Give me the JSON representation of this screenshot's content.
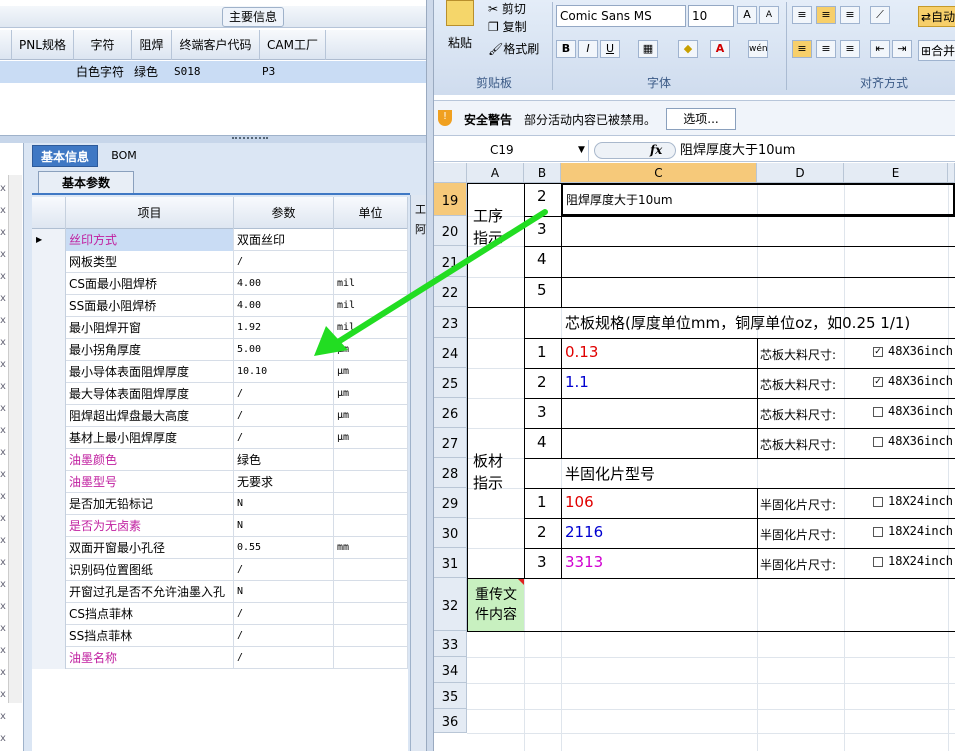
{
  "top_grid": {
    "group_title": "主要信息",
    "columns": [
      "PNL规格",
      "字符",
      "阻焊",
      "终端客户代码",
      "CAM工厂"
    ],
    "row": {
      "char": "白色字符",
      "solder": "绿色",
      "code": "S018",
      "factory": "P3"
    }
  },
  "param_panel": {
    "tabs": [
      "基本信息",
      "BOM"
    ],
    "subtab": "基本参数",
    "headers": [
      "项目",
      "参数",
      "单位"
    ],
    "right_tab_label": "工",
    "right_tab_label2": "阿",
    "rows": [
      {
        "item": "丝印方式",
        "value": "双面丝印",
        "unit": "",
        "highlight": true
      },
      {
        "item": "网板类型",
        "value": "/",
        "unit": ""
      },
      {
        "item": "CS面最小阻焊桥",
        "value": "4.00",
        "unit": "mil"
      },
      {
        "item": "SS面最小阻焊桥",
        "value": "4.00",
        "unit": "mil"
      },
      {
        "item": "最小阻焊开窗",
        "value": "1.92",
        "unit": "mil"
      },
      {
        "item": "最小拐角厚度",
        "value": "5.00",
        "unit": "μm"
      },
      {
        "item": "最小导体表面阻焊厚度",
        "value": "10.10",
        "unit": "μm"
      },
      {
        "item": "最大导体表面阻焊厚度",
        "value": "/",
        "unit": "μm"
      },
      {
        "item": "阻焊超出焊盘最大高度",
        "value": "/",
        "unit": "μm"
      },
      {
        "item": "基材上最小阻焊厚度",
        "value": "/",
        "unit": "μm"
      },
      {
        "item": "油墨颜色",
        "value": "绿色",
        "unit": "",
        "highlight": true
      },
      {
        "item": "油墨型号",
        "value": "无要求",
        "unit": "",
        "highlight": true
      },
      {
        "item": "是否加无铅标记",
        "value": "N",
        "unit": ""
      },
      {
        "item": "是否为无卤素",
        "value": "N",
        "unit": "",
        "highlight": true
      },
      {
        "item": "双面开窗最小孔径",
        "value": "0.55",
        "unit": "mm"
      },
      {
        "item": "识别码位置图纸",
        "value": "/",
        "unit": ""
      },
      {
        "item": "开窗过孔是否不允许油墨入孔",
        "value": "N",
        "unit": ""
      },
      {
        "item": "CS挡点菲林",
        "value": "/",
        "unit": ""
      },
      {
        "item": "SS挡点菲林",
        "value": "/",
        "unit": ""
      },
      {
        "item": "油墨名称",
        "value": "/",
        "unit": "",
        "highlight": true
      }
    ]
  },
  "ribbon": {
    "paste": "粘贴",
    "cut": "剪切",
    "copy": "复制",
    "format_painter": "格式刷",
    "clipboard_group": "剪贴板",
    "font_name": "Comic Sans MS",
    "font_size": "10",
    "font_group": "字体",
    "align_group": "对齐方式",
    "autowrap": "自动",
    "merge": "合并"
  },
  "security": {
    "title": "安全警告",
    "message": "部分活动内容已被禁用。",
    "options_button": "选项..."
  },
  "formula_bar": {
    "name_box": "C19",
    "fx": "fx",
    "content": "阻焊厚度大于10um"
  },
  "sheet": {
    "columns": [
      "A",
      "B",
      "C",
      "D",
      "E"
    ],
    "rows": [
      "19",
      "20",
      "21",
      "22",
      "23",
      "24",
      "25",
      "26",
      "27",
      "28",
      "29",
      "30",
      "31",
      "32",
      "33",
      "34",
      "35",
      "36"
    ],
    "process_label": "工序\n指示",
    "process_items": [
      {
        "n": "2",
        "text": "阻焊厚度大于10um"
      },
      {
        "n": "3",
        "text": ""
      },
      {
        "n": "4",
        "text": ""
      },
      {
        "n": "5",
        "text": ""
      }
    ],
    "board_label": "板材\n指示",
    "core_title": "芯板规格(厚度单位mm，铜厚单位oz，如0.25 1/1)",
    "core_rows": [
      {
        "n": "1",
        "value": "0.13",
        "color": "#e00000",
        "label": "芯板大料尺寸:",
        "checked": true,
        "size": "48X36inch"
      },
      {
        "n": "2",
        "value": "1.1",
        "color": "#0000d0",
        "label": "芯板大料尺寸:",
        "checked": true,
        "size": "48X36inch"
      },
      {
        "n": "3",
        "value": "",
        "color": "#000000",
        "label": "芯板大料尺寸:",
        "checked": false,
        "size": "48X36inch"
      },
      {
        "n": "4",
        "value": "",
        "color": "#000000",
        "label": "芯板大料尺寸:",
        "checked": false,
        "size": "48X36inch"
      }
    ],
    "prepreg_title": "半固化片型号",
    "prepreg_rows": [
      {
        "n": "1",
        "value": "106",
        "color": "#e00000",
        "label": "半固化片尺寸:",
        "size": "18X24inch"
      },
      {
        "n": "2",
        "value": "2116",
        "color": "#0000d0",
        "label": "半固化片尺寸:",
        "size": "18X24inch"
      },
      {
        "n": "3",
        "value": "3313",
        "color": "#d000d0",
        "label": "半固化片尺寸:",
        "size": "18X24inch"
      }
    ],
    "reupload_label": "重传文\n件内容"
  },
  "colors": {
    "arrow": "#22dd22",
    "tab_active": "#3f78c4",
    "highlight_text": "#c020a0"
  }
}
